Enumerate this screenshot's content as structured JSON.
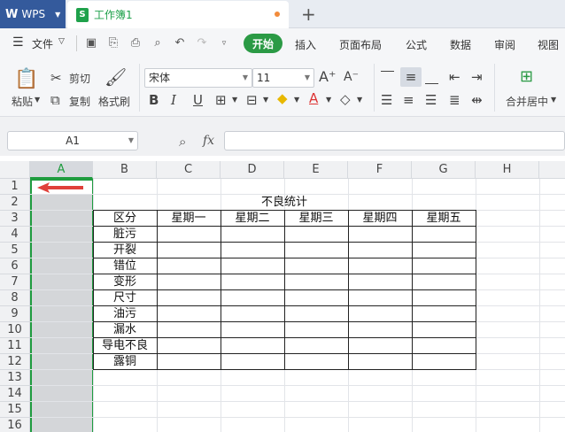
{
  "tabs": {
    "wps_label": "WPS",
    "doc_label": "工作簿1",
    "new_tab": "+"
  },
  "menu": {
    "file": "文件",
    "items": [
      "开始",
      "插入",
      "页面布局",
      "公式",
      "数据",
      "审阅",
      "视图"
    ]
  },
  "ribbon": {
    "paste": "粘贴",
    "cut": "剪切",
    "copy": "复制",
    "format_painter": "格式刷",
    "font_name": "宋体",
    "font_size": "11",
    "merge_center": "合并居中"
  },
  "formula": {
    "name_box": "A1",
    "fx": "fx"
  },
  "sheet": {
    "columns": [
      "A",
      "B",
      "C",
      "D",
      "E",
      "F",
      "G",
      "H"
    ],
    "rows": [
      "1",
      "2",
      "3",
      "4",
      "5",
      "6",
      "7",
      "8",
      "9",
      "10",
      "11",
      "12",
      "13",
      "14",
      "15",
      "16"
    ],
    "title": "不良统计",
    "header_corner": "区分",
    "weekdays": [
      "星期一",
      "星期二",
      "星期三",
      "星期四",
      "星期五"
    ],
    "categories": [
      "脏污",
      "开裂",
      "错位",
      "变形",
      "尺寸",
      "油污",
      "漏水",
      "导电不良",
      "露铜"
    ]
  },
  "colors": {
    "accent": "#2b9a45",
    "selection": "#1f9c3f",
    "arrow": "#e0403a",
    "wps_blue": "#345a9c"
  }
}
